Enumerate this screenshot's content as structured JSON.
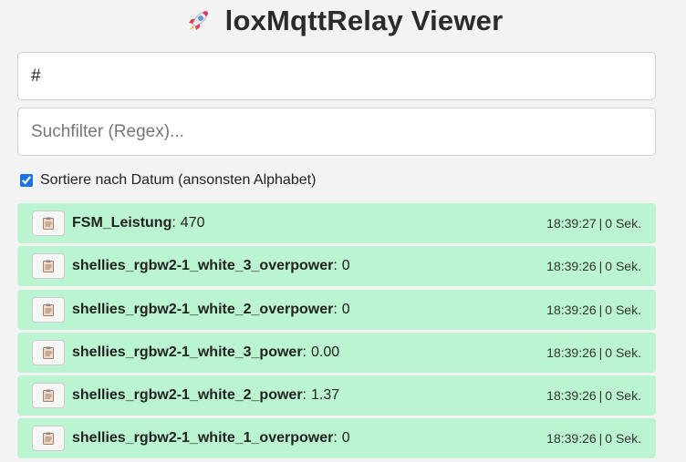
{
  "header": {
    "title": "loxMqttRelay Viewer",
    "icon": "rocket-icon"
  },
  "topic_input": {
    "value": "#"
  },
  "filter_input": {
    "value": "",
    "placeholder": "Suchfilter (Regex)..."
  },
  "sort": {
    "label": "Sortiere nach Datum (ansonsten Alphabet)",
    "checked": true
  },
  "colors": {
    "row_bg": "#bbf4d0"
  },
  "entries": [
    {
      "name": "FSM_Leistung",
      "value": "470",
      "time": "18:39:27",
      "age": "0 Sek."
    },
    {
      "name": "shellies_rgbw2-1_white_3_overpower",
      "value": "0",
      "time": "18:39:26",
      "age": "0 Sek."
    },
    {
      "name": "shellies_rgbw2-1_white_2_overpower",
      "value": "0",
      "time": "18:39:26",
      "age": "0 Sek."
    },
    {
      "name": "shellies_rgbw2-1_white_3_power",
      "value": "0.00",
      "time": "18:39:26",
      "age": "0 Sek."
    },
    {
      "name": "shellies_rgbw2-1_white_2_power",
      "value": "1.37",
      "time": "18:39:26",
      "age": "0 Sek."
    },
    {
      "name": "shellies_rgbw2-1_white_1_overpower",
      "value": "0",
      "time": "18:39:26",
      "age": "0 Sek."
    }
  ]
}
